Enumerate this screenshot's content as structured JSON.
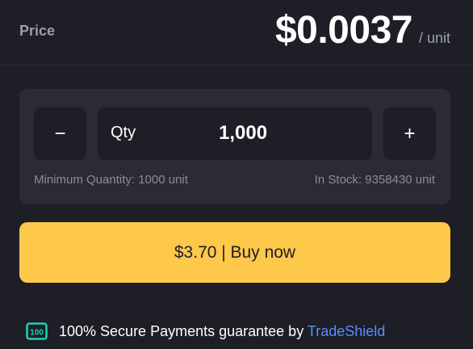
{
  "price": {
    "label": "Price",
    "amount": "$0.0037",
    "unit": "/ unit"
  },
  "quantity": {
    "decrement_icon": "minus-icon",
    "decrement_label": "−",
    "increment_icon": "plus-icon",
    "increment_label": "+",
    "label": "Qty",
    "value": "1,000",
    "minimum_text": "Minimum Quantity: 1000 unit",
    "stock_text": "In Stock: 9358430 unit"
  },
  "buy": {
    "label": "$3.70 | Buy now",
    "color": "#fec84b"
  },
  "secure": {
    "icon": "shield-100-icon",
    "icon_text": "100",
    "text": "100% Secure Payments guarantee by ",
    "brand": "TradeShield",
    "brand_color": "#5b8cff",
    "icon_color": "#19d4b4"
  }
}
